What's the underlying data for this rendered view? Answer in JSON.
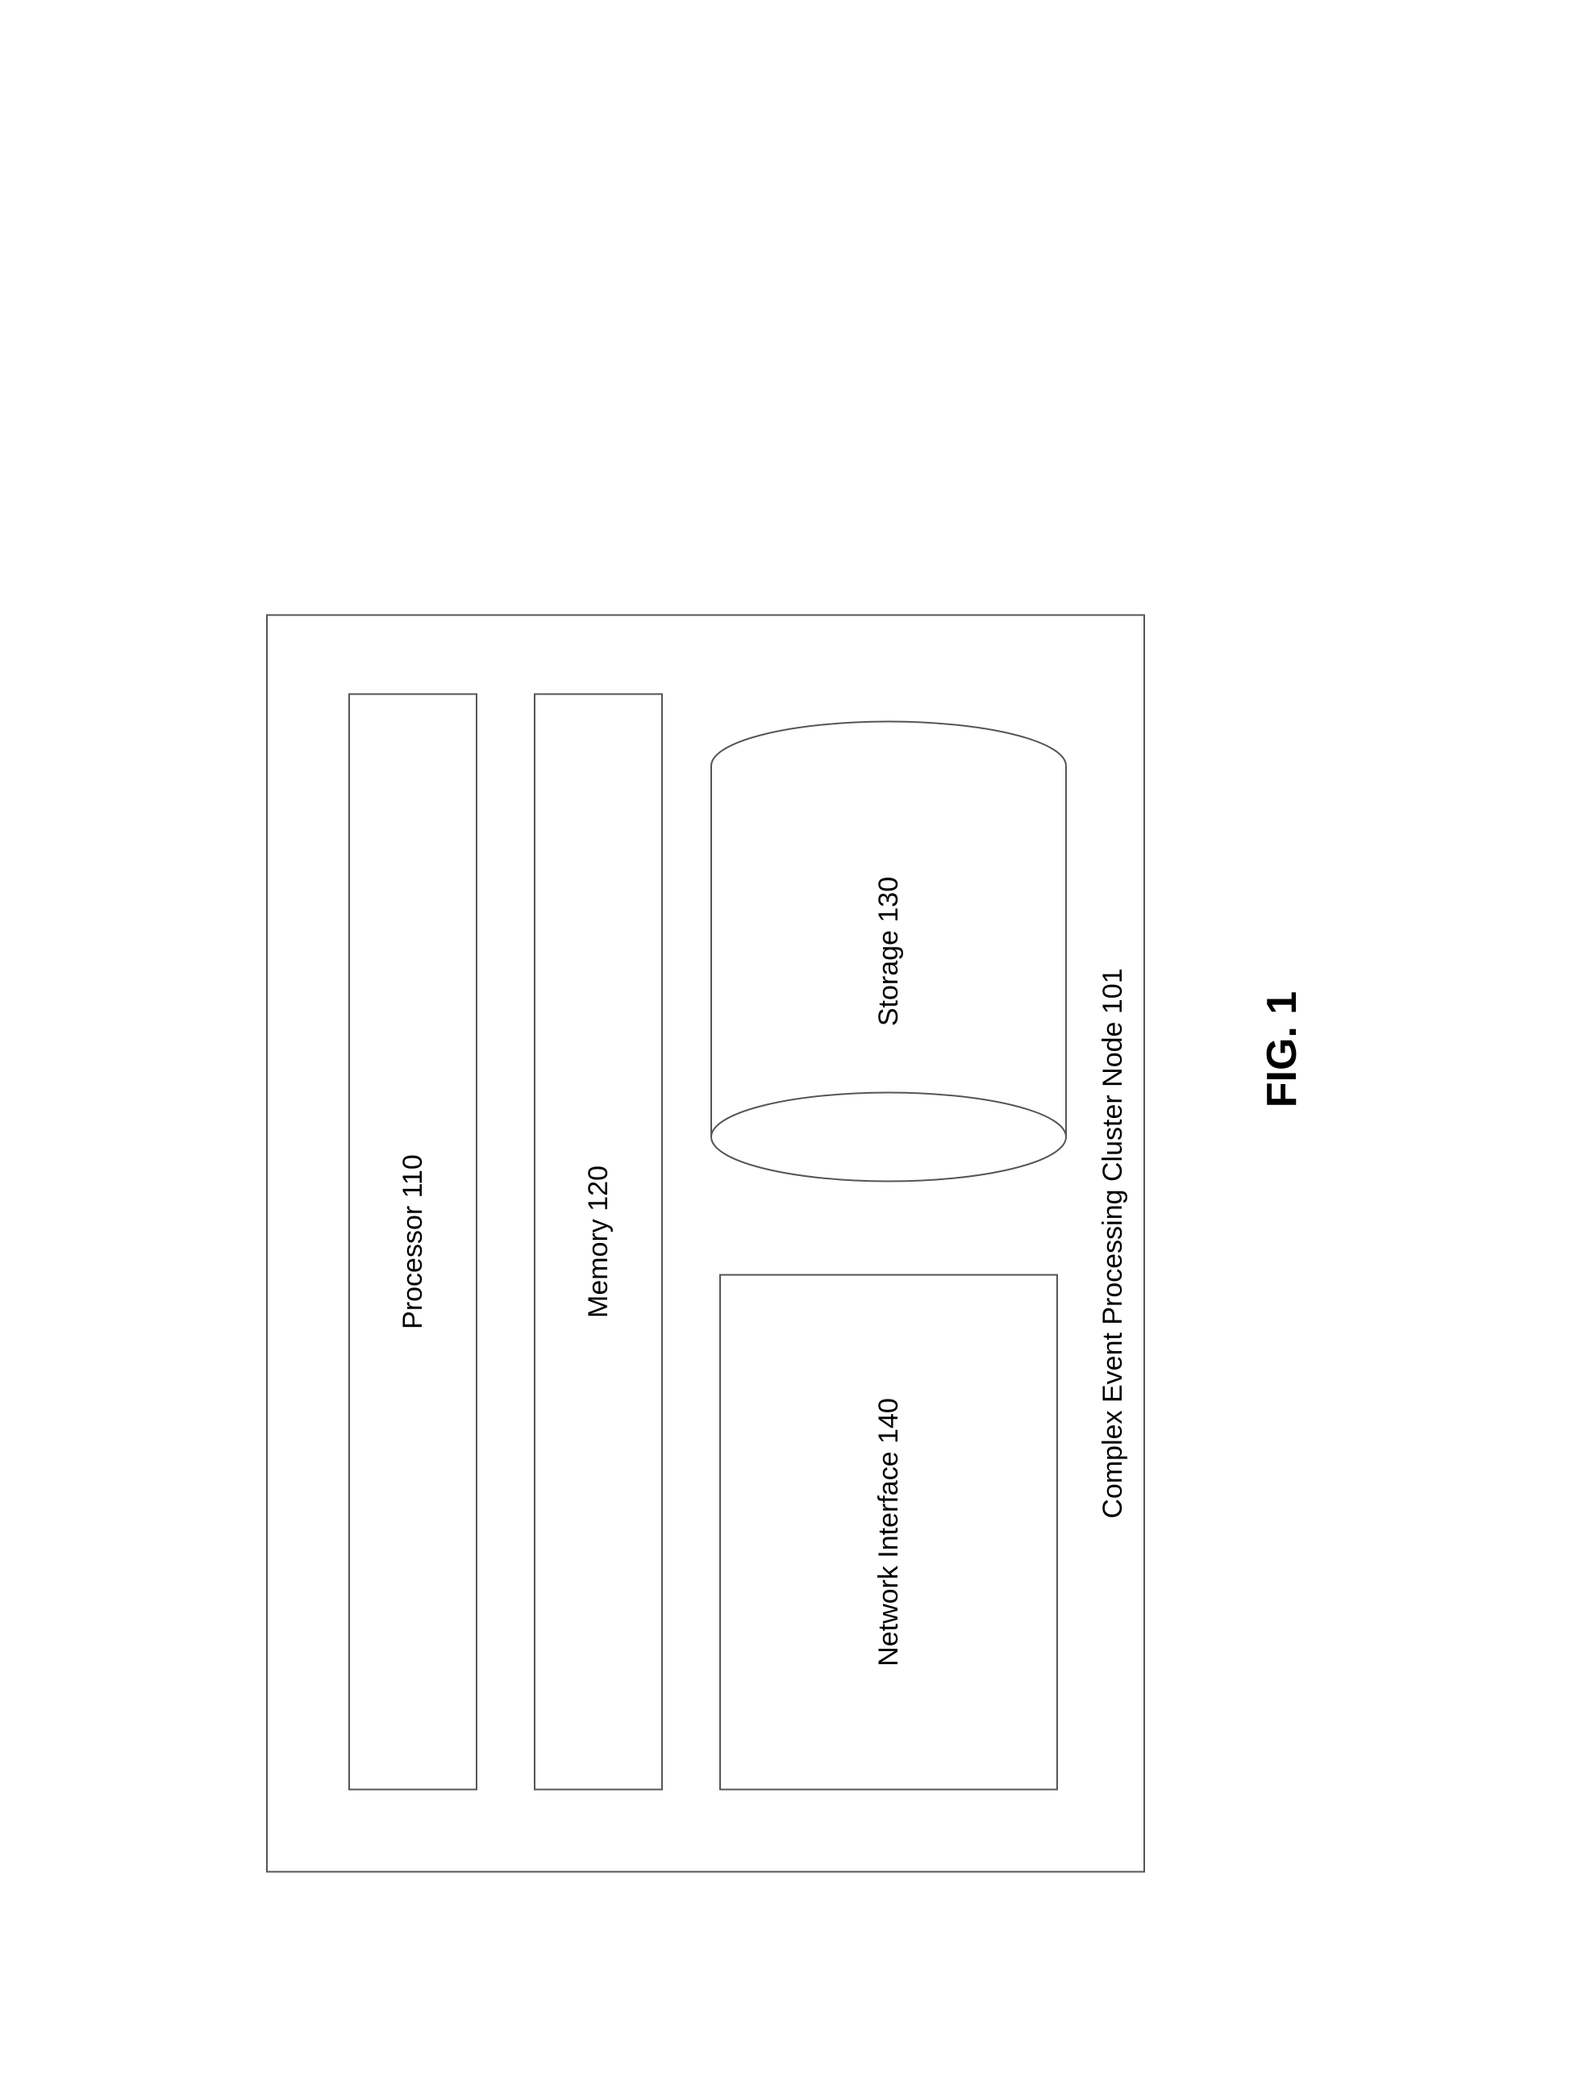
{
  "figure_label": "FIG. 1",
  "outer_caption": "Complex Event Processing Cluster Node 101",
  "components": {
    "processor": "Processor 110",
    "memory": "Memory 120",
    "storage": "Storage 130",
    "network": "Network Interface 140"
  }
}
